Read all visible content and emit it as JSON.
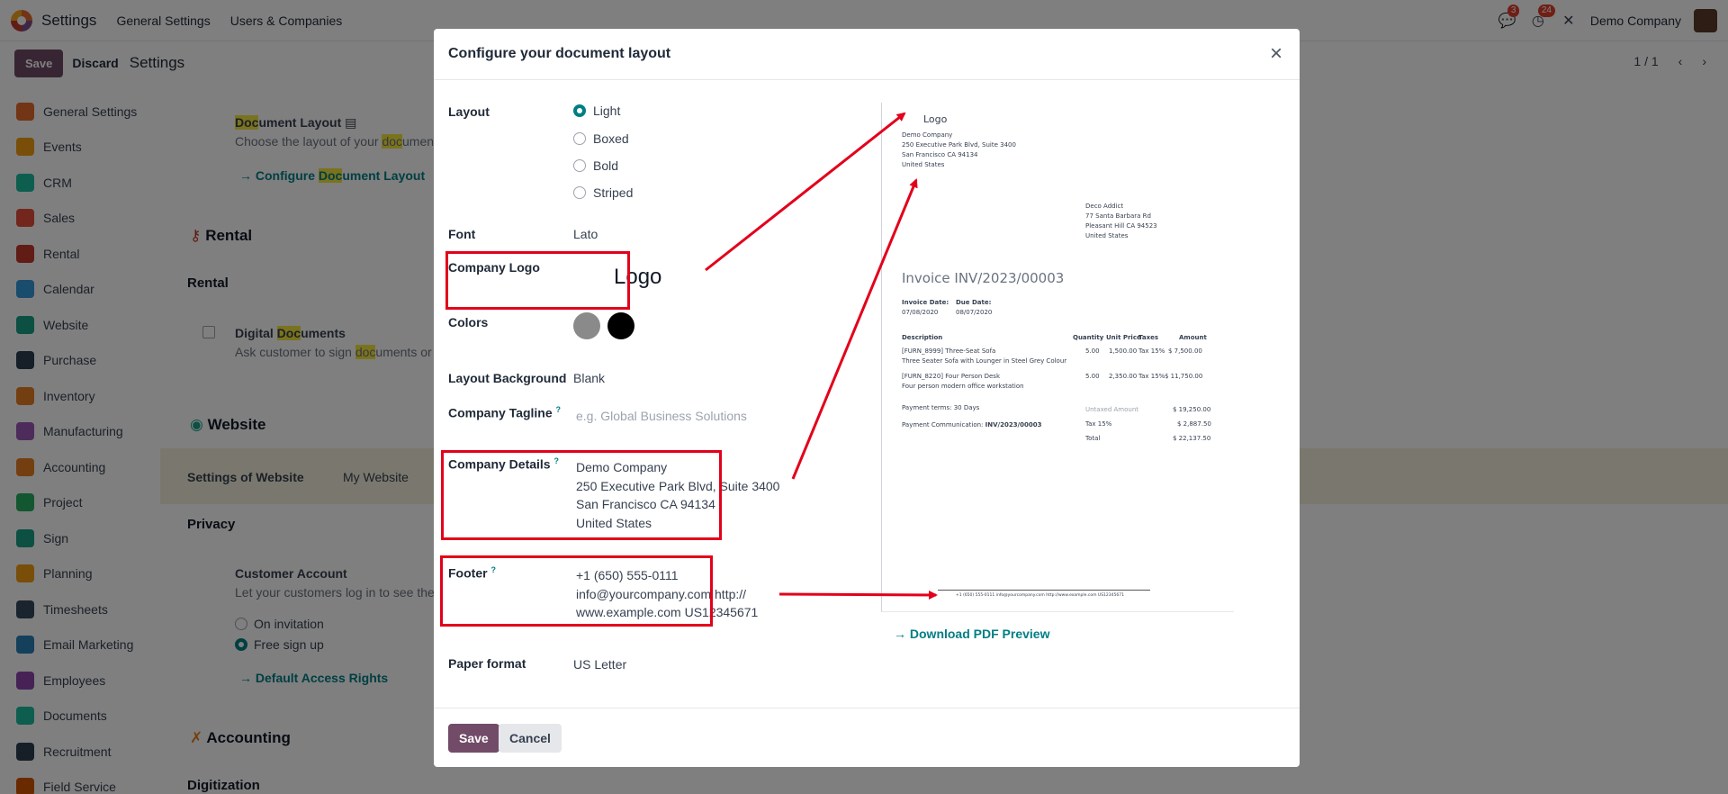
{
  "topnav": {
    "app_name": "Settings",
    "links": [
      "General Settings",
      "Users & Companies"
    ],
    "chat_badge": "3",
    "activity_badge": "24",
    "company": "Demo Company"
  },
  "controlbar": {
    "save": "Save",
    "discard": "Discard",
    "title": "Settings",
    "pager": "1 / 1"
  },
  "sidebar": {
    "items": [
      {
        "label": "General Settings",
        "color": "#e46b2b"
      },
      {
        "label": "Events",
        "color": "#f39c12"
      },
      {
        "label": "CRM",
        "color": "#1abc9c"
      },
      {
        "label": "Sales",
        "color": "#e74c3c"
      },
      {
        "label": "Rental",
        "color": "#c0392b"
      },
      {
        "label": "Calendar",
        "color": "#3498db"
      },
      {
        "label": "Website",
        "color": "#16a085"
      },
      {
        "label": "Purchase",
        "color": "#2c3e50"
      },
      {
        "label": "Inventory",
        "color": "#e67e22"
      },
      {
        "label": "Manufacturing",
        "color": "#9b59b6"
      },
      {
        "label": "Accounting",
        "color": "#e67e22"
      },
      {
        "label": "Project",
        "color": "#27ae60"
      },
      {
        "label": "Sign",
        "color": "#16a085"
      },
      {
        "label": "Planning",
        "color": "#f39c12"
      },
      {
        "label": "Timesheets",
        "color": "#34495e"
      },
      {
        "label": "Email Marketing",
        "color": "#2980b9"
      },
      {
        "label": "Employees",
        "color": "#8e44ad"
      },
      {
        "label": "Documents",
        "color": "#1abc9c"
      },
      {
        "label": "Recruitment",
        "color": "#2c3e50"
      },
      {
        "label": "Field Service",
        "color": "#d35400"
      }
    ]
  },
  "background": {
    "doc_layout_label_pre": "Doc",
    "doc_layout_label_post": "ument Layout",
    "doc_layout_desc_pre": "Choose the layout of your ",
    "doc_layout_desc_hl": "doc",
    "doc_layout_desc_post": "umen",
    "configure_link_pre": "Configure ",
    "configure_link_hl": "Doc",
    "configure_link_post": "ument Layout",
    "rental_section": "Rental",
    "rental_sub": "Rental",
    "digital_docs_pre": "Digital ",
    "digital_docs_hl": "Doc",
    "digital_docs_post": "uments",
    "digital_docs_desc_pre": "Ask customer to sign ",
    "digital_docs_desc_hl": "doc",
    "digital_docs_desc_post": "uments or",
    "website_section": "Website",
    "settings_of_website": "Settings of Website",
    "my_website": "My Website",
    "privacy": "Privacy",
    "customer_account": "Customer Account",
    "customer_account_desc": "Let your customers log in to see the",
    "on_invitation": "On invitation",
    "free_signup": "Free sign up",
    "default_access": "Default Access Rights",
    "accounting_section": "Accounting",
    "digitization": "Digitization"
  },
  "modal": {
    "title": "Configure your document layout",
    "layout_label": "Layout",
    "layout_options": [
      "Light",
      "Boxed",
      "Bold",
      "Striped"
    ],
    "layout_selected": "Light",
    "font_label": "Font",
    "font_value": "Lato",
    "logo_label": "Company Logo",
    "logo_text": "Logo",
    "colors_label": "Colors",
    "colors": [
      "#8a8a8a",
      "#000000"
    ],
    "bg_label": "Layout Background",
    "bg_value": "Blank",
    "tagline_label": "Company Tagline",
    "tagline_placeholder": "e.g. Global Business Solutions",
    "details_label": "Company Details",
    "details_lines": [
      "Demo Company",
      "250 Executive Park Blvd, Suite 3400",
      "San Francisco CA 94134",
      "United States"
    ],
    "footer_label": "Footer",
    "footer_lines": [
      "+1 (650) 555-0111",
      "info@yourcompany.com http://",
      "www.example.com US12345671"
    ],
    "paper_label": "Paper format",
    "paper_value": "US Letter",
    "help_mark": "?",
    "save": "Save",
    "cancel": "Cancel",
    "download_link": "Download PDF Preview"
  },
  "preview": {
    "logo": "Logo",
    "company_lines": [
      "Demo Company",
      "250 Executive Park Blvd, Suite 3400",
      "San Francisco CA 94134",
      "United States"
    ],
    "customer_lines": [
      "Deco Addict",
      "77 Santa Barbara Rd",
      "Pleasant Hill CA 94523",
      "United States"
    ],
    "invoice_title": "Invoice INV/2023/00003",
    "invoice_date_label": "Invoice Date:",
    "invoice_date": "07/08/2020",
    "due_date_label": "Due Date:",
    "due_date": "08/07/2020",
    "columns": [
      "Description",
      "Quantity",
      "Unit Price",
      "Taxes",
      "Amount"
    ],
    "rows": [
      {
        "desc": "[FURN_8999] Three-Seat Sofa",
        "desc2": "Three Seater Sofa with Lounger in Steel Grey Colour",
        "qty": "5.00",
        "price": "1,500.00",
        "tax": "Tax 15%",
        "amount": "$ 7,500.00"
      },
      {
        "desc": "[FURN_8220] Four Person Desk",
        "desc2": "Four person modern office workstation",
        "qty": "5.00",
        "price": "2,350.00",
        "tax": "Tax 15%",
        "amount": "$ 11,750.00"
      }
    ],
    "payment_terms": "Payment terms: 30 Days",
    "payment_comm_label": "Payment Communication:",
    "payment_comm": "INV/2023/00003",
    "untaxed_label": "Untaxed Amount",
    "untaxed": "$ 19,250.00",
    "tax_label": "Tax 15%",
    "tax": "$ 2,887.50",
    "total_label": "Total",
    "total": "$ 22,137.50",
    "footer_line": "+1 (650) 555-0111 info@yourcompany.com http://www.example.com US12345671"
  }
}
